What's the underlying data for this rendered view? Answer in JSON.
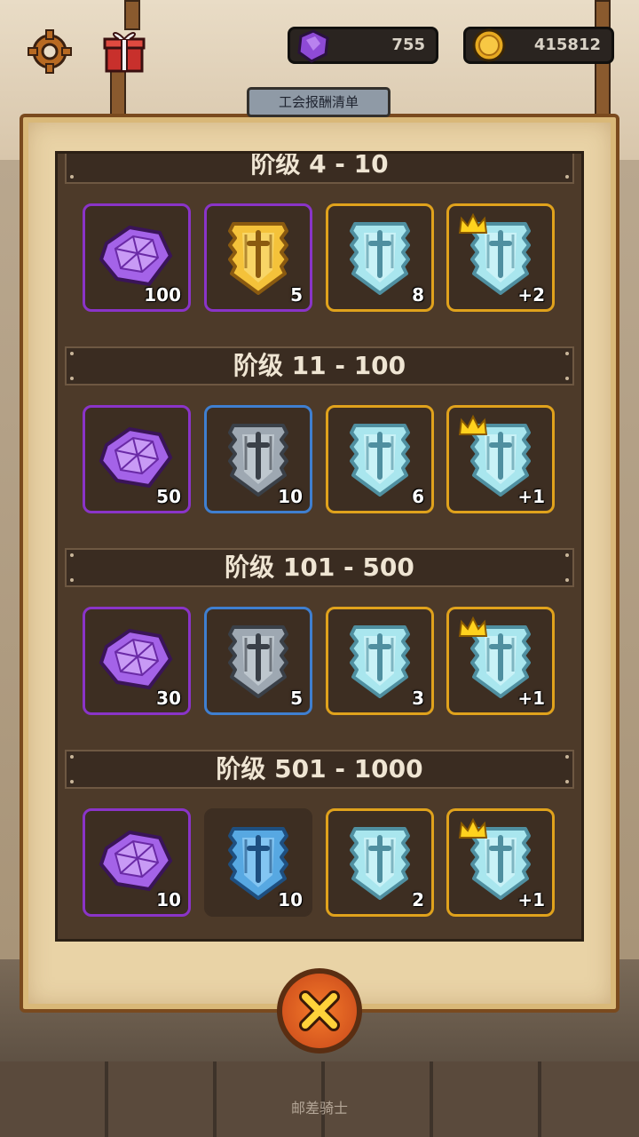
{
  "header": {
    "gem_count": "755",
    "coin_count": "415812"
  },
  "panel": {
    "title": "工会报酬清单"
  },
  "tiers": [
    {
      "label": "阶级 4 - 10",
      "rewards": [
        {
          "icon": "purple-gem-icon",
          "rarity": "purple",
          "qty": "100"
        },
        {
          "icon": "gold-shield-icon",
          "rarity": "purple",
          "qty": "5"
        },
        {
          "icon": "ice-shield-icon",
          "rarity": "gold",
          "qty": "8"
        },
        {
          "icon": "ice-shield-icon",
          "rarity": "gold",
          "qty": "+2",
          "crown": true
        }
      ]
    },
    {
      "label": "阶级 11 - 100",
      "rewards": [
        {
          "icon": "purple-gem-icon",
          "rarity": "purple",
          "qty": "50"
        },
        {
          "icon": "silver-shield-icon",
          "rarity": "blue",
          "qty": "10"
        },
        {
          "icon": "ice-shield-icon",
          "rarity": "gold",
          "qty": "6"
        },
        {
          "icon": "ice-shield-icon",
          "rarity": "gold",
          "qty": "+1",
          "crown": true
        }
      ]
    },
    {
      "label": "阶级 101 - 500",
      "rewards": [
        {
          "icon": "purple-gem-icon",
          "rarity": "purple",
          "qty": "30"
        },
        {
          "icon": "silver-shield-icon",
          "rarity": "blue",
          "qty": "5"
        },
        {
          "icon": "ice-shield-icon",
          "rarity": "gold",
          "qty": "3"
        },
        {
          "icon": "ice-shield-icon",
          "rarity": "gold",
          "qty": "+1",
          "crown": true
        }
      ]
    },
    {
      "label": "阶级 501 - 1000",
      "rewards": [
        {
          "icon": "purple-gem-icon",
          "rarity": "purple",
          "qty": "10"
        },
        {
          "icon": "blue-shield-icon",
          "rarity": "none",
          "qty": "10"
        },
        {
          "icon": "ice-shield-icon",
          "rarity": "gold",
          "qty": "2"
        },
        {
          "icon": "ice-shield-icon",
          "rarity": "gold",
          "qty": "+1",
          "crown": true
        }
      ]
    }
  ],
  "footer": {
    "label": "邮差骑士"
  },
  "colors": {
    "purple": "#8a34c8",
    "gold": "#e0a21c",
    "blue": "#3f7fd0"
  }
}
